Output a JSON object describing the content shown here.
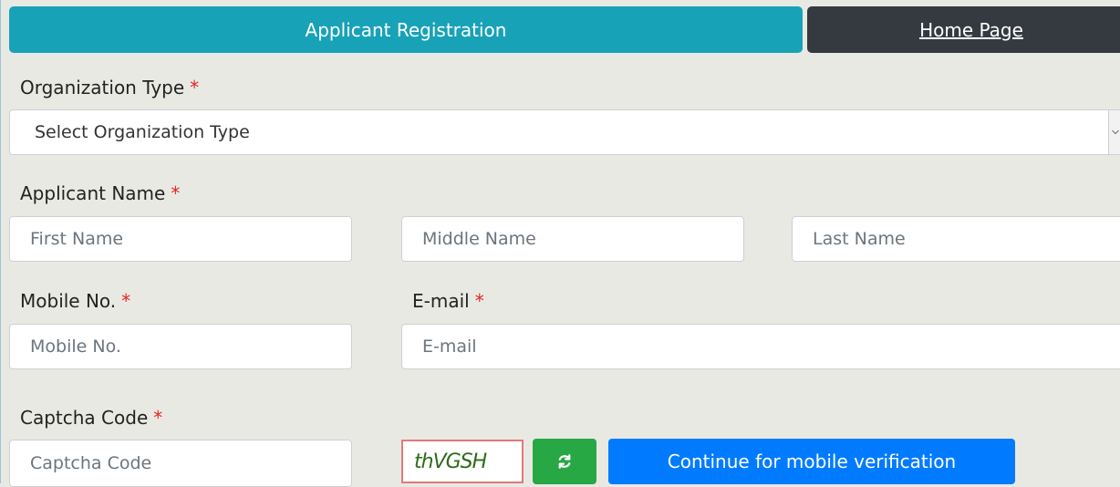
{
  "tabs": {
    "register_label": "Applicant Registration",
    "home_label": "Home Page"
  },
  "required_marker": "*",
  "organization": {
    "label": "Organization Type",
    "selected": "Select Organization Type"
  },
  "applicant_name": {
    "label": "Applicant Name",
    "first_placeholder": "First Name",
    "middle_placeholder": "Middle Name",
    "last_placeholder": "Last Name"
  },
  "mobile": {
    "label": "Mobile No.",
    "placeholder": "Mobile No."
  },
  "email": {
    "label": "E-mail",
    "placeholder": "E-mail"
  },
  "captcha": {
    "label": "Captcha Code",
    "placeholder": "Captcha Code",
    "code": "thVGSH"
  },
  "buttons": {
    "continue_label": "Continue for mobile verification"
  },
  "icons": {
    "refresh": "refresh-icon",
    "dropdown": "chevron-down-icon"
  },
  "colors": {
    "tab_active": "#17a2b8",
    "tab_home": "#343a40",
    "required": "#e3261e",
    "refresh_button": "#28a745",
    "continue_button": "#007bff"
  }
}
